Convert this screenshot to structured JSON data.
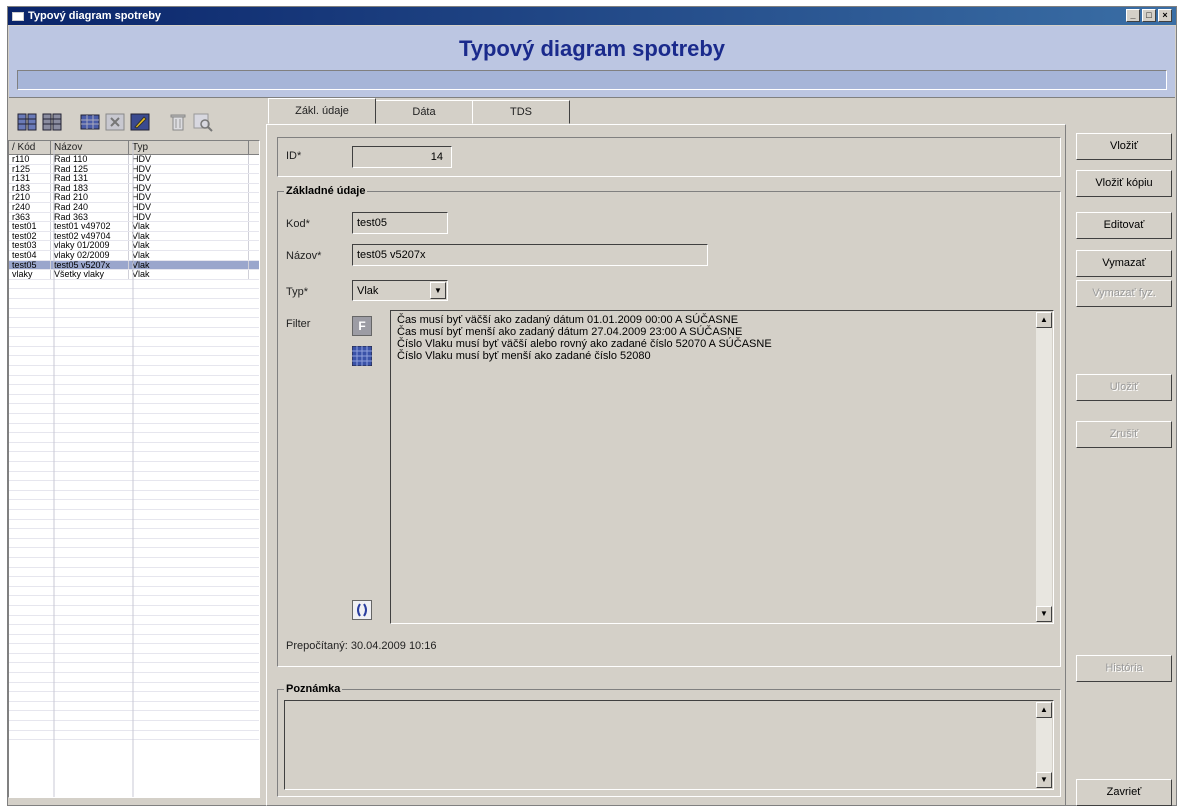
{
  "window": {
    "title": "Typový diagram spotreby",
    "controls": [
      "_",
      "□",
      "×"
    ]
  },
  "banner": {
    "title": "Typový diagram spotreby"
  },
  "toolbar": {
    "icons": [
      "grid-view-1-icon",
      "grid-view-2-icon",
      "table-icon",
      "delete-x-icon",
      "edit-icon",
      "trash-icon",
      "find-icon"
    ]
  },
  "grid": {
    "columns": [
      "/ Kód",
      "Názov",
      "Typ"
    ],
    "rows": [
      {
        "code": "r110",
        "name": "Rad 110",
        "type": "HDV",
        "selected": false
      },
      {
        "code": "r125",
        "name": "Rad 125",
        "type": "HDV",
        "selected": false
      },
      {
        "code": "r131",
        "name": "Rad 131",
        "type": "HDV",
        "selected": false
      },
      {
        "code": "r183",
        "name": "Rad 183",
        "type": "HDV",
        "selected": false
      },
      {
        "code": "r210",
        "name": "Rad 210",
        "type": "HDV",
        "selected": false
      },
      {
        "code": "r240",
        "name": "Rad 240",
        "type": "HDV",
        "selected": false
      },
      {
        "code": "r363",
        "name": "Rad 363",
        "type": "HDV",
        "selected": false
      },
      {
        "code": "test01",
        "name": "test01 v49702",
        "type": "Vlak",
        "selected": false
      },
      {
        "code": "test02",
        "name": "test02 v49704",
        "type": "Vlak",
        "selected": false
      },
      {
        "code": "test03",
        "name": "vlaky 01/2009",
        "type": "Vlak",
        "selected": false
      },
      {
        "code": "test04",
        "name": "vlaky 02/2009",
        "type": "Vlak",
        "selected": false
      },
      {
        "code": "test05",
        "name": "test05 v5207x",
        "type": "Vlak",
        "selected": true
      },
      {
        "code": "vlaky",
        "name": "Všetky vlaky",
        "type": "Vlak",
        "selected": false
      }
    ]
  },
  "tabs": [
    {
      "label": "Zákl. údaje",
      "active": true
    },
    {
      "label": "Dáta",
      "active": false
    },
    {
      "label": "TDS",
      "active": false
    }
  ],
  "form": {
    "id_label": "ID*",
    "id_value": "14",
    "basic_group_title": "Základné údaje",
    "code_label": "Kod*",
    "code_value": "test05",
    "name_label": "Názov*",
    "name_value": "test05 v5207x",
    "type_label": "Typ*",
    "type_value": "Vlak",
    "filter_label": "Filter",
    "filter_lines": [
      "Čas musí byť väčší ako zadaný dátum 01.01.2009 00:00 A SÚČASNE",
      "Čas musí byť menší ako zadaný dátum 27.04.2009 23:00 A SÚČASNE",
      "Číslo Vlaku musí byť väčší alebo rovný ako zadané číslo 52070 A SÚČASNE",
      "Číslo Vlaku musí byť menší ako zadané číslo 52080"
    ],
    "filter_button_label": "F",
    "recalculated_label": "Prepočítaný:",
    "recalculated_value": "30.04.2009 10:16",
    "note_group_title": "Poznámka"
  },
  "actions": [
    {
      "label": "Vložiť",
      "enabled": true
    },
    {
      "label": "Vložiť kópiu",
      "enabled": true
    },
    {
      "label": "Editovať",
      "enabled": true
    },
    {
      "label": "Vymazať",
      "enabled": true
    },
    {
      "label": "Vymazať fyz.",
      "enabled": false
    },
    {
      "label": "Uložiť",
      "enabled": false
    },
    {
      "label": "Zrušiť",
      "enabled": false
    },
    {
      "label": "História",
      "enabled": false
    },
    {
      "label": "Zavrieť",
      "enabled": true
    }
  ],
  "colors": {
    "title_bar": "#0a246a",
    "banner": "#bcc6e2",
    "banner_title": "#1a2a8c",
    "selected_row": "#9aa6cc",
    "window_face": "#d4d0c8"
  }
}
